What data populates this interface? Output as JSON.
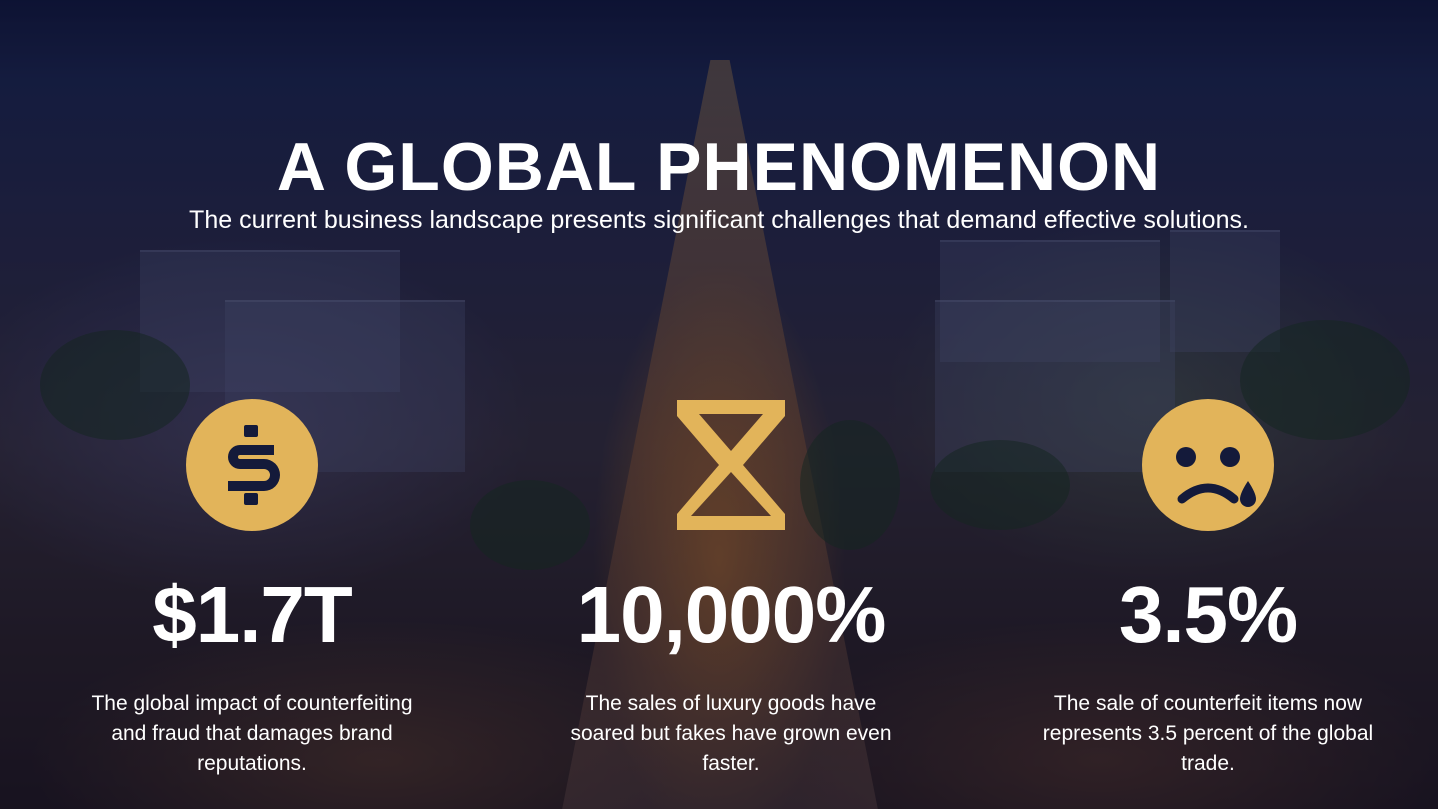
{
  "accent_color": "#e2b45a",
  "title": "A GLOBAL PHENOMENON",
  "subtitle": "The current business landscape presents significant challenges that demand effective solutions.",
  "stats": [
    {
      "icon": "dollar-coin-icon",
      "value": "$1.7T",
      "description": "The global impact of counterfeiting and fraud that damages brand reputations."
    },
    {
      "icon": "hourglass-icon",
      "value": "10,000%",
      "description": "The sales of luxury goods have soared but fakes have grown even faster."
    },
    {
      "icon": "sad-face-icon",
      "value": "3.5%",
      "description": "The sale of counterfeit items now represents 3.5 percent of the global trade."
    }
  ]
}
